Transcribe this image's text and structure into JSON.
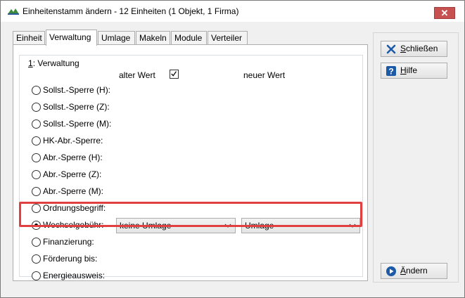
{
  "window": {
    "title": "Einheitenstamm ändern - 12 Einheiten (1 Objekt, 1 Firma)",
    "close_label": "✕"
  },
  "tabs": [
    {
      "label": "Einheit"
    },
    {
      "label": "Verwaltung",
      "active": true
    },
    {
      "label": "Umlage"
    },
    {
      "label": "Makeln"
    },
    {
      "label": "Module"
    },
    {
      "label": "Verteiler"
    }
  ],
  "group": {
    "mnemonic": "1",
    "title_rest": ": Verwaltung",
    "old_value_header": "alter Wert",
    "new_value_header": "neuer Wert",
    "old_value_checked": true
  },
  "rows": [
    {
      "label": "Sollst.-Sperre (H):"
    },
    {
      "label": "Sollst.-Sperre (Z):"
    },
    {
      "label": "Sollst.-Sperre (M):"
    },
    {
      "label": "HK-Abr.-Sperre:"
    },
    {
      "label": "Abr.-Sperre (H):"
    },
    {
      "label": "Abr.-Sperre (Z):"
    },
    {
      "label": "Abr.-Sperre (M):"
    },
    {
      "label": "Ordnungsbegriff:"
    },
    {
      "label": "Wechselgebühr:",
      "checked": true,
      "old_value": "keine Umlage",
      "new_value": "Umlage"
    },
    {
      "label": "Finanzierung:"
    },
    {
      "label": "Förderung bis:"
    },
    {
      "label": "Energieausweis:"
    }
  ],
  "buttons": {
    "close": {
      "mnemonic": "S",
      "rest": "chließen",
      "icon": "x-icon"
    },
    "help": {
      "mnemonic": "H",
      "rest": "ilfe",
      "icon": "question-icon"
    },
    "change": {
      "mnemonic": "Ä",
      "rest": "ndern",
      "icon": "play-icon"
    }
  },
  "colors": {
    "highlight": "#e0403f",
    "close_button": "#c75050",
    "accent_blue": "#1c5aa8"
  }
}
